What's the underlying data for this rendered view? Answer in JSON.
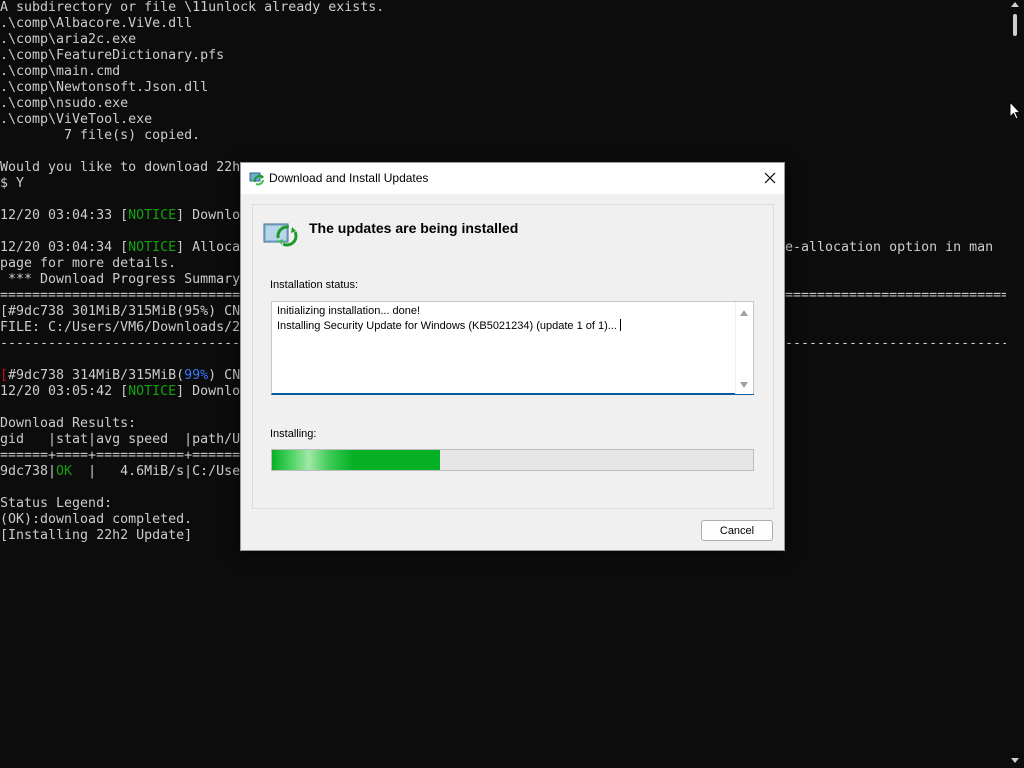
{
  "console": {
    "lines": [
      "A subdirectory or file \\11unlock already exists.",
      ".\\comp\\Albacore.ViVe.dll",
      ".\\comp\\aria2c.exe",
      ".\\comp\\FeatureDictionary.pfs",
      ".\\comp\\main.cmd",
      ".\\comp\\Newtonsoft.Json.dll",
      ".\\comp\\nsudo.exe",
      ".\\comp\\ViVeTool.exe",
      "        7 file(s) copied.",
      "Would you like to download 22h",
      "$ Y",
      "12/20 03:04:33 [",
      "NOTICE",
      "] Downlo",
      "12/20 03:04:34 [",
      "NOTICE",
      "] Alloca",
      "e-allocation option in man",
      "page for more details.",
      " *** Download Progress Summary",
      "==============================",
      "==========================================",
      "[#9dc738 301MiB/315MiB(95%) CN",
      "FILE: C:/Users/VM6/Downloads/2",
      "------------------------------",
      "------------------------------------------",
      "[",
      "#9dc738 314MiB/315MiB(",
      "99%",
      ") CN",
      "12/20 03:05:42 [",
      "NOTICE",
      "] Downlo",
      "Download Results:",
      "gid   |stat|avg speed  |path/U",
      "======+====+===========+======",
      "9dc738|",
      "OK",
      "  |   4.6MiB/s|C:/Use",
      "Status Legend:",
      "(OK):download completed.",
      "[Installing 22h2 Update]"
    ]
  },
  "dialog": {
    "title": "Download and Install Updates",
    "heading": "The updates are being installed",
    "status_label": "Installation status:",
    "status_lines": [
      "Initializing installation... done!",
      "Installing Security Update for Windows (KB5021234) (update 1 of 1)..."
    ],
    "progress_label": "Installing:",
    "progress_fraction": 0.35,
    "cancel_label": "Cancel"
  },
  "colors": {
    "console_bg": "#0c0c0c",
    "console_text": "#cccccc",
    "notice_green": "#13a10e",
    "percent_blue": "#3b78ff",
    "progress_green": "#06b025"
  },
  "icons": [
    "windows-update-icon",
    "close-icon",
    "update-arrows-icon",
    "mouse-pointer-icon"
  ]
}
